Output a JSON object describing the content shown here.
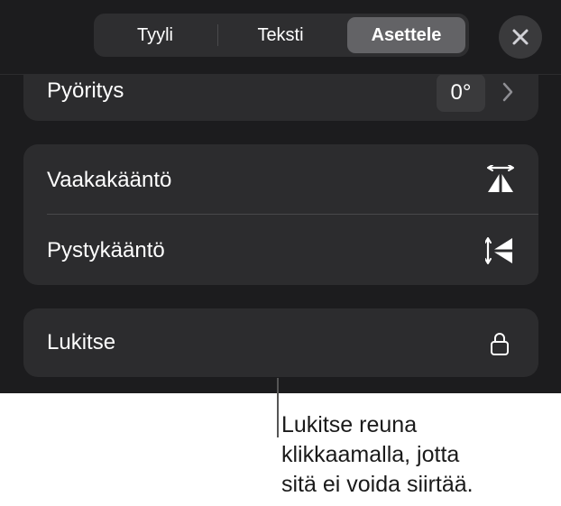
{
  "tabs": [
    {
      "label": "Tyyli",
      "selected": false
    },
    {
      "label": "Teksti",
      "selected": false
    },
    {
      "label": "Asettele",
      "selected": true
    }
  ],
  "close_icon": "close-icon",
  "rotation": {
    "label": "Pyöritys",
    "value": "0°"
  },
  "flip": {
    "horizontal_label": "Vaakakääntö",
    "vertical_label": "Pystykääntö"
  },
  "lock": {
    "label": "Lukitse"
  },
  "callout": {
    "line1": "Lukitse reuna",
    "line2": "klikkaamalla, jotta",
    "line3": "sitä ei voida siirtää."
  },
  "colors": {
    "panel_bg": "#1c1c1e",
    "card_bg": "#2c2c2e",
    "selected_tab": "#636366"
  }
}
